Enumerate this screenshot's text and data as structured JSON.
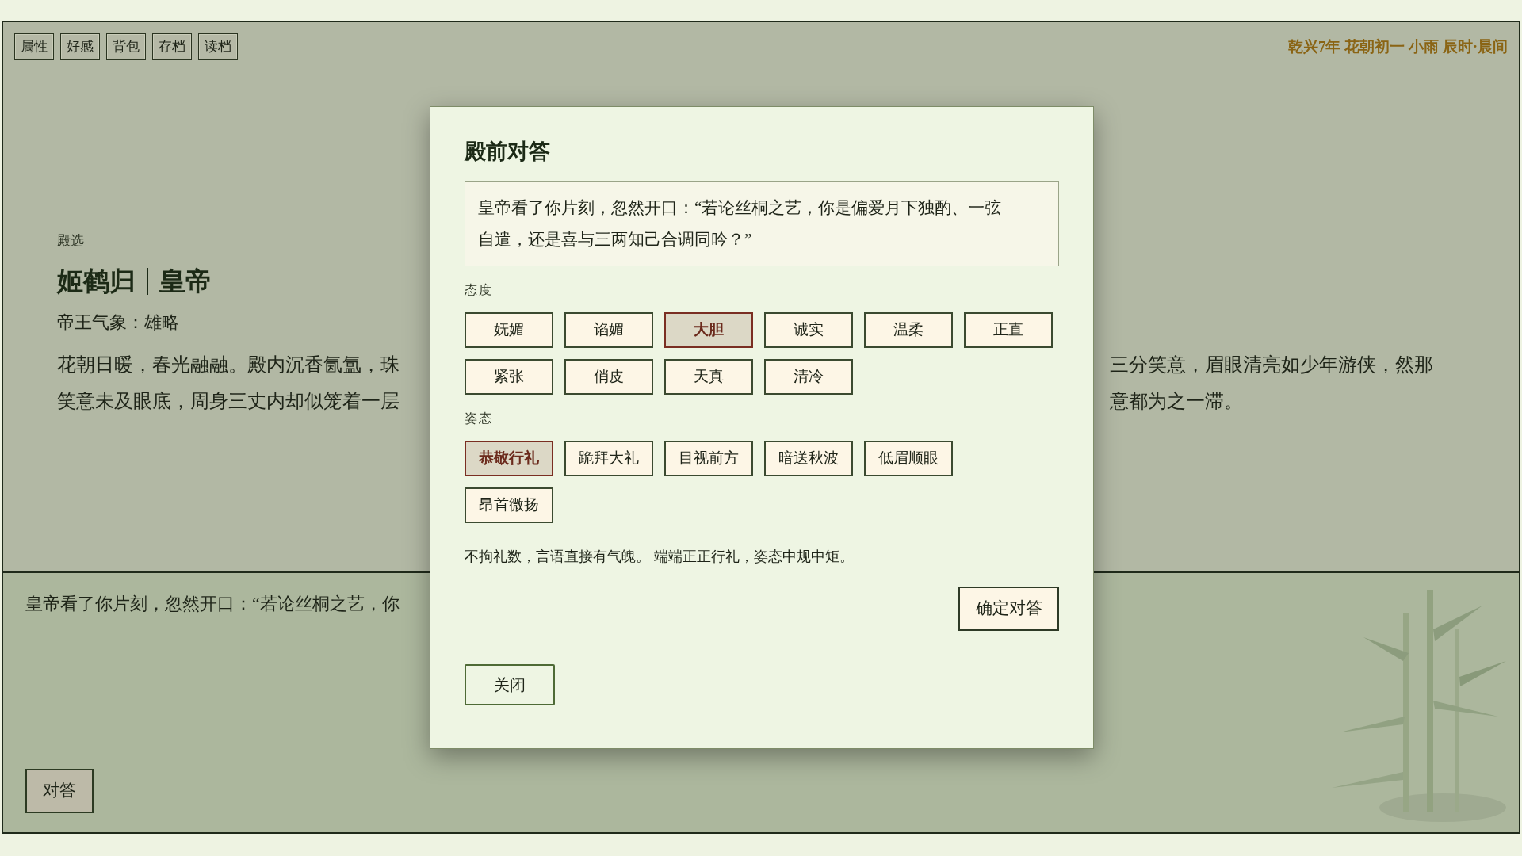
{
  "toolbar": {
    "buttons": [
      "属性",
      "好感",
      "背包",
      "存档",
      "读档"
    ],
    "date_text": "乾兴7年 花朝初一 小雨 辰时·晨间"
  },
  "scene": {
    "label": "殿选",
    "name": "姬鹤归",
    "role": "皇帝",
    "trait": "帝王气象：雄略",
    "text_left": [
      "花朝日暖，春光融融。殿内沉香氤氲，珠",
      "笑意未及眼底，周身三丈内却似笼着一层"
    ],
    "text_right": [
      "三分笑意，眉眼清亮如少年游侠，然那",
      "意都为之一滞。"
    ]
  },
  "log": {
    "text": "皇帝看了你片刻，忽然开口：“若论丝桐之艺，你",
    "button": "对答"
  },
  "modal": {
    "title": "殿前对答",
    "question": "皇帝看了你片刻，忽然开口：“若论丝桐之艺，你是偏爱月下独酌、一弦自遣，还是喜与三两知己合调同吟？”",
    "sections": [
      {
        "label": "态度",
        "options": [
          {
            "label": "妩媚",
            "selected": false
          },
          {
            "label": "谄媚",
            "selected": false
          },
          {
            "label": "大胆",
            "selected": true
          },
          {
            "label": "诚实",
            "selected": false
          },
          {
            "label": "温柔",
            "selected": false
          },
          {
            "label": "正直",
            "selected": false
          },
          {
            "label": "紧张",
            "selected": false
          },
          {
            "label": "俏皮",
            "selected": false
          },
          {
            "label": "天真",
            "selected": false
          },
          {
            "label": "清冷",
            "selected": false
          }
        ]
      },
      {
        "label": "姿态",
        "options": [
          {
            "label": "恭敬行礼",
            "selected": true
          },
          {
            "label": "跪拜大礼",
            "selected": false
          },
          {
            "label": "目视前方",
            "selected": false
          },
          {
            "label": "暗送秋波",
            "selected": false
          },
          {
            "label": "低眉顺眼",
            "selected": false
          },
          {
            "label": "昂首微扬",
            "selected": false
          }
        ]
      }
    ],
    "summary": "不拘礼数，言语直接有气魄。 端端正正行礼，姿态中规中矩。",
    "confirm": "确定对答",
    "close": "关闭"
  }
}
